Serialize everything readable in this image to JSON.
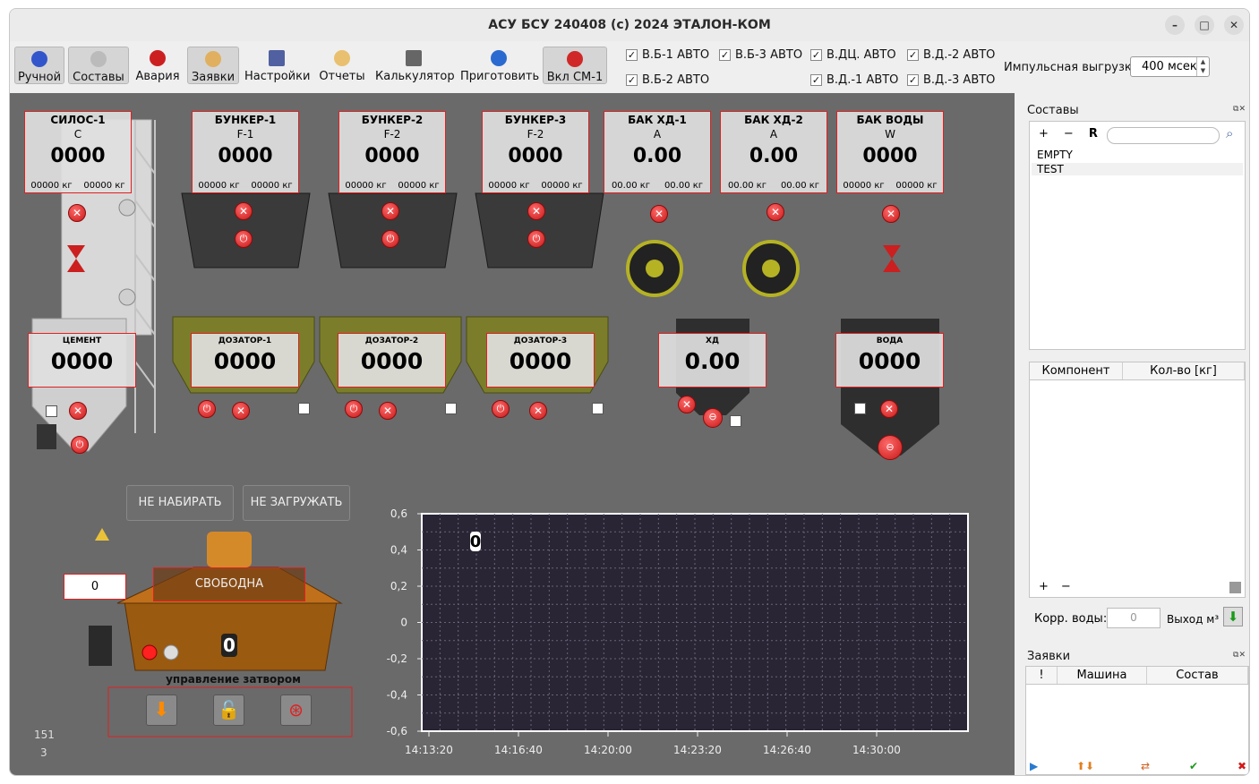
{
  "window": {
    "title": "АСУ БСУ 240408 (c) 2024 ЭТАЛОН-КОМ"
  },
  "toolbar": {
    "buttons": [
      "Ручной",
      "Составы",
      "Авария",
      "Заявки",
      "Настройки",
      "Отчеты",
      "Калькулятор",
      "Приготовить",
      "Вкл СМ-1"
    ]
  },
  "checks": [
    "В.Б-1 АВТО",
    "В.Б-3 АВТО",
    "В.ДЦ. АВТО",
    "В.Д.-2 АВТО",
    "В.Б-2 АВТО",
    "В.Д.-1 АВТО",
    "В.Д.-3 АВТО"
  ],
  "impulse": {
    "label": "Импульсная выгрузка",
    "value": "400 мсек"
  },
  "top_panels": [
    {
      "title": "СИЛОС-1",
      "sub": "C",
      "value": "0000",
      "left": "00000 кг",
      "right": "00000 кг"
    },
    {
      "title": "БУНКЕР-1",
      "sub": "F-1",
      "value": "0000",
      "left": "00000 кг",
      "right": "00000 кг"
    },
    {
      "title": "БУНКЕР-2",
      "sub": "F-2",
      "value": "0000",
      "left": "00000 кг",
      "right": "00000 кг"
    },
    {
      "title": "БУНКЕР-3",
      "sub": "F-2",
      "value": "0000",
      "left": "00000 кг",
      "right": "00000 кг"
    },
    {
      "title": "БАК ХД-1",
      "sub": "A",
      "value": "0.00",
      "left": "00.00 кг",
      "right": "00.00 кг"
    },
    {
      "title": "БАК ХД-2",
      "sub": "A",
      "value": "0.00",
      "left": "00.00 кг",
      "right": "00.00 кг"
    },
    {
      "title": "БАК ВОДЫ",
      "sub": "W",
      "value": "0000",
      "left": "00000 кг",
      "right": "00000 кг"
    }
  ],
  "doser_panels": [
    {
      "title": "ЦЕМЕНТ",
      "value": "0000"
    },
    {
      "title": "ДОЗАТОР-1",
      "value": "0000"
    },
    {
      "title": "ДОЗАТОР-2",
      "value": "0000"
    },
    {
      "title": "ДОЗАТОР-3",
      "value": "0000"
    },
    {
      "title": "ХД",
      "value": "0.00"
    },
    {
      "title": "ВОДА",
      "value": "0000"
    }
  ],
  "controls": {
    "no_collect": "НЕ НАБИРАТЬ",
    "no_load": "НЕ ЗАГРУЖАТЬ",
    "counter": "0",
    "mixer_state": "СВОБОДНА",
    "mixer_value": "0",
    "gate_label": "управление затвором",
    "num1": "151",
    "num2": "3"
  },
  "chart_data": {
    "type": "line",
    "title": "",
    "xlabel": "",
    "ylabel": "",
    "x_ticks": [
      "14:13:20",
      "14:16:40",
      "14:20:00",
      "14:23:20",
      "14:26:40",
      "14:30:00"
    ],
    "y_ticks": [
      "0,6",
      "0,4",
      "0,2",
      "0",
      "-0,2",
      "-0,4",
      "-0,6"
    ],
    "ylim": [
      -0.6,
      0.6
    ],
    "series": [],
    "marker_label": "0",
    "grid": true
  },
  "recipes_dock": {
    "title": "Составы",
    "tools": [
      "+",
      "−",
      "R"
    ],
    "search_placeholder": "",
    "items": [
      "EMPTY",
      "TEST"
    ],
    "cols": [
      "Компонент",
      "Кол-во [кг]"
    ],
    "bottom_tools": [
      "+",
      "−"
    ],
    "water_label": "Корр. воды:",
    "water_value": "0",
    "output_label": "Выход м³"
  },
  "orders_dock": {
    "title": "Заявки",
    "cols": [
      "!",
      "Машина",
      "Состав"
    ]
  },
  "colors": {
    "accent_red": "#e02020",
    "chart_bg": "#2a2535",
    "olive": "#7b7d2a"
  }
}
